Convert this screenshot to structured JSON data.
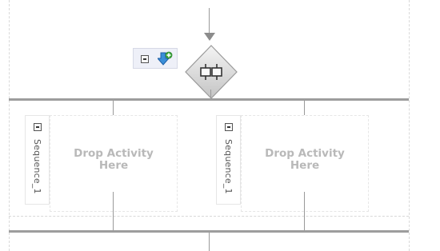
{
  "canvas": {
    "background": "#ffffff",
    "connector_color": "#9a9a9a",
    "bar_color": "#9d9d9d",
    "drop_text_color": "#b9b9b9"
  },
  "gateway": {
    "icon": "parallel-split-gateway-icon",
    "toolbar": {
      "collapse_icon": "collapse-icon",
      "add_branch_icon": "add-branch-icon"
    }
  },
  "branches": [
    {
      "sequence_label": "Sequence_1",
      "collapse_icon": "collapse-icon",
      "drop_line1": "Drop Activity",
      "drop_line2": "Here"
    },
    {
      "sequence_label": "Sequence_1",
      "collapse_icon": "collapse-icon",
      "drop_line1": "Drop Activity",
      "drop_line2": "Here"
    }
  ]
}
